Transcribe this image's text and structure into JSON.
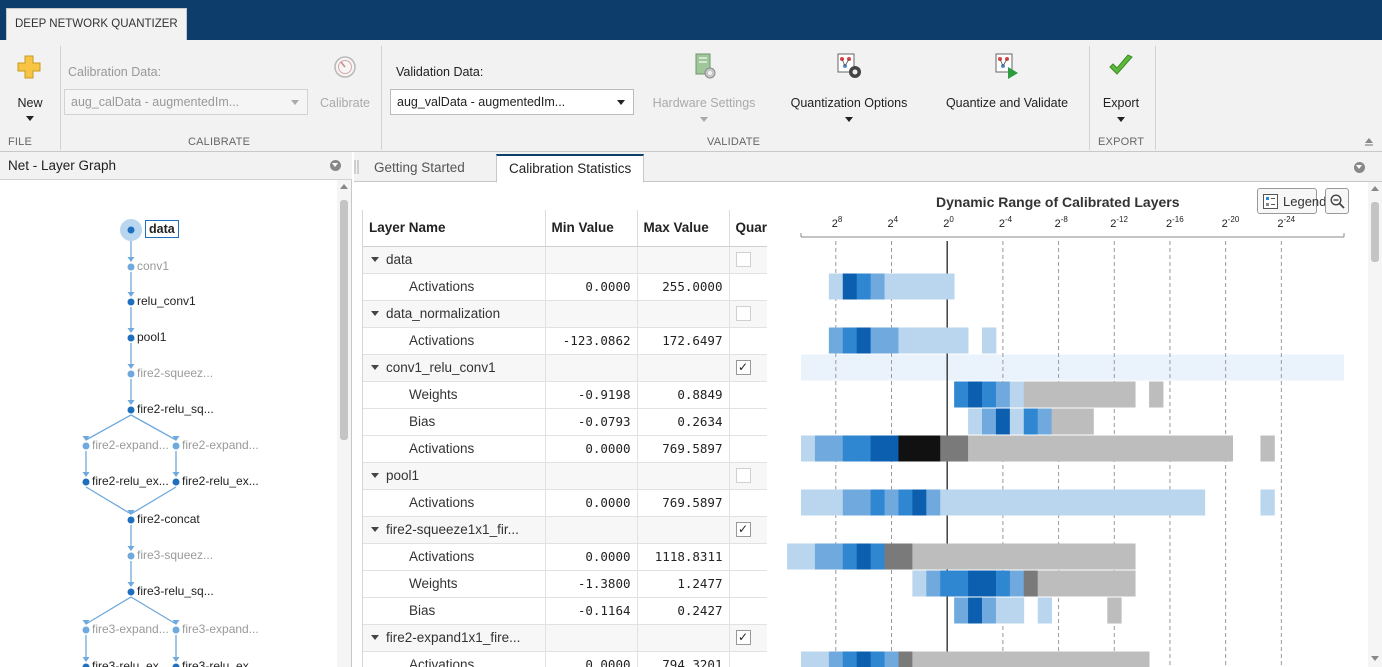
{
  "app": {
    "tab_title": "DEEP NETWORK QUANTIZER"
  },
  "toolstrip": {
    "file": {
      "section": "FILE",
      "new_label": "New"
    },
    "calibrate": {
      "section": "CALIBRATE",
      "calibration_data_label": "Calibration Data:",
      "calibration_data_value": "aug_calData - augmentedIm...",
      "calibrate_label": "Calibrate"
    },
    "validate": {
      "section": "VALIDATE",
      "validation_data_label": "Validation Data:",
      "validation_data_value": "aug_valData - augmentedIm...",
      "hardware_settings_label": "Hardware Settings",
      "quantization_options_label": "Quantization Options",
      "quantize_validate_label": "Quantize and Validate"
    },
    "export": {
      "section": "EXPORT",
      "export_label": "Export"
    }
  },
  "left_panel": {
    "title": "Net - Layer Graph",
    "nodes": [
      {
        "label": "data",
        "active": true,
        "dim": false
      },
      {
        "label": "conv1",
        "active": false,
        "dim": true
      },
      {
        "label": "relu_conv1",
        "active": false,
        "dim": false
      },
      {
        "label": "pool1",
        "active": false,
        "dim": false
      },
      {
        "label": "fire2-squeez...",
        "active": false,
        "dim": true
      },
      {
        "label": "fire2-relu_sq...",
        "active": false,
        "dim": false
      },
      {
        "label": "fire2-expand...",
        "active": false,
        "dim": true
      },
      {
        "label": "fire2-expand...",
        "active": false,
        "dim": true
      },
      {
        "label": "fire2-relu_ex...",
        "active": false,
        "dim": false
      },
      {
        "label": "fire2-relu_ex...",
        "active": false,
        "dim": false
      },
      {
        "label": "fire2-concat",
        "active": false,
        "dim": false
      },
      {
        "label": "fire3-squeez...",
        "active": false,
        "dim": true
      },
      {
        "label": "fire3-relu_sq...",
        "active": false,
        "dim": false
      },
      {
        "label": "fire3-expand...",
        "active": false,
        "dim": true
      },
      {
        "label": "fire3-expand...",
        "active": false,
        "dim": true
      },
      {
        "label": "fire3-relu_ex...",
        "active": false,
        "dim": false
      },
      {
        "label": "fire3-relu_ex...",
        "active": false,
        "dim": false
      }
    ]
  },
  "doc_tabs": [
    {
      "label": "Getting Started",
      "active": false
    },
    {
      "label": "Calibration Statistics",
      "active": true
    }
  ],
  "table": {
    "columns": [
      "Layer Name",
      "Min Value",
      "Max Value",
      "Quar"
    ],
    "rows": [
      {
        "type": "group",
        "name": "data",
        "checked": false,
        "enabled": false
      },
      {
        "type": "child",
        "name": "Activations",
        "min": "0.0000",
        "max": "255.0000"
      },
      {
        "type": "group",
        "name": "data_normalization",
        "checked": false,
        "enabled": false
      },
      {
        "type": "child",
        "name": "Activations",
        "min": "-123.0862",
        "max": "172.6497"
      },
      {
        "type": "group",
        "name": "conv1_relu_conv1",
        "checked": true,
        "enabled": true
      },
      {
        "type": "child",
        "name": "Weights",
        "min": "-0.9198",
        "max": "0.8849"
      },
      {
        "type": "child",
        "name": "Bias",
        "min": "-0.0793",
        "max": "0.2634"
      },
      {
        "type": "child",
        "name": "Activations",
        "min": "0.0000",
        "max": "769.5897"
      },
      {
        "type": "group",
        "name": "pool1",
        "checked": false,
        "enabled": false
      },
      {
        "type": "child",
        "name": "Activations",
        "min": "0.0000",
        "max": "769.5897"
      },
      {
        "type": "group",
        "name": "fire2-squeeze1x1_fir...",
        "checked": true,
        "enabled": true
      },
      {
        "type": "child",
        "name": "Activations",
        "min": "0.0000",
        "max": "1118.8311"
      },
      {
        "type": "child",
        "name": "Weights",
        "min": "-1.3800",
        "max": "1.2477"
      },
      {
        "type": "child",
        "name": "Bias",
        "min": "-0.1164",
        "max": "0.2427"
      },
      {
        "type": "group",
        "name": "fire2-expand1x1_fire...",
        "checked": true,
        "enabled": true
      },
      {
        "type": "child",
        "name": "Activations",
        "min": "0.0000",
        "max": "794.3201"
      }
    ]
  },
  "chart": {
    "title": "Dynamic Range of Calibrated Layers",
    "legend_label": "Legend",
    "colors": {
      "dark_blue": "#0b5fae",
      "blue": "#2f86d1",
      "mid_blue": "#6fa9dd",
      "light_blue": "#bad6ee",
      "gray": "#bdbdbd",
      "dark_gray": "#7a7a7a",
      "black": "#111111",
      "highlight_row": "#eaf3fb"
    }
  },
  "chart_data": {
    "type": "heatmap",
    "title": "Dynamic Range of Calibrated Layers",
    "x_tick_labels": [
      {
        "base": "2",
        "exp": "8"
      },
      {
        "base": "2",
        "exp": "4"
      },
      {
        "base": "2",
        "exp": "0"
      },
      {
        "base": "2",
        "exp": "-4"
      },
      {
        "base": "2",
        "exp": "-8"
      },
      {
        "base": "2",
        "exp": "-12"
      },
      {
        "base": "2",
        "exp": "-16"
      },
      {
        "base": "2",
        "exp": "-20"
      },
      {
        "base": "2",
        "exp": "-24"
      }
    ],
    "x_exponent_range": [
      11,
      -28
    ],
    "rows": [
      {
        "table_row": 1,
        "cells": [
          [
            8,
            "lb"
          ],
          [
            7,
            "db"
          ],
          [
            6,
            "b"
          ],
          [
            5,
            "mb"
          ],
          [
            4,
            "lb"
          ],
          [
            3,
            "lb"
          ],
          [
            2,
            "lb"
          ],
          [
            1,
            "lb"
          ],
          [
            0,
            "lb"
          ]
        ]
      },
      {
        "table_row": 3,
        "cells": [
          [
            8,
            "mb"
          ],
          [
            7,
            "b"
          ],
          [
            6,
            "db"
          ],
          [
            5,
            "mb"
          ],
          [
            4,
            "mb"
          ],
          [
            3,
            "lb"
          ],
          [
            2,
            "lb"
          ],
          [
            1,
            "lb"
          ],
          [
            0,
            "lb"
          ],
          [
            -1,
            "lb"
          ],
          [
            -3,
            "lb"
          ]
        ]
      },
      {
        "table_row": 4,
        "highlight": true,
        "cells": []
      },
      {
        "table_row": 5,
        "cells": [
          [
            -1,
            "b"
          ],
          [
            -2,
            "db"
          ],
          [
            -3,
            "b"
          ],
          [
            -4,
            "mb"
          ],
          [
            -5,
            "lb"
          ],
          [
            -6,
            "gray"
          ],
          [
            -7,
            "gray"
          ],
          [
            -8,
            "gray"
          ],
          [
            -9,
            "gray"
          ],
          [
            -10,
            "gray"
          ],
          [
            -11,
            "gray"
          ],
          [
            -12,
            "gray"
          ],
          [
            -13,
            "gray"
          ],
          [
            -15,
            "gray"
          ]
        ]
      },
      {
        "table_row": 6,
        "cells": [
          [
            -2,
            "lb"
          ],
          [
            -3,
            "mb"
          ],
          [
            -4,
            "db"
          ],
          [
            -5,
            "lb"
          ],
          [
            -6,
            "b"
          ],
          [
            -7,
            "mb"
          ],
          [
            -8,
            "gray"
          ],
          [
            -9,
            "gray"
          ],
          [
            -10,
            "gray"
          ]
        ]
      },
      {
        "table_row": 7,
        "cells": [
          [
            10,
            "lb"
          ],
          [
            9,
            "mb"
          ],
          [
            8,
            "mb"
          ],
          [
            7,
            "b"
          ],
          [
            6,
            "b"
          ],
          [
            5,
            "db"
          ],
          [
            4,
            "db"
          ],
          [
            3,
            "black"
          ],
          [
            2,
            "black"
          ],
          [
            1,
            "black"
          ],
          [
            0,
            "dgray"
          ],
          [
            -1,
            "dgray"
          ],
          [
            -2,
            "gray"
          ],
          [
            -3,
            "gray"
          ],
          [
            -4,
            "gray"
          ],
          [
            -5,
            "gray"
          ],
          [
            -6,
            "gray"
          ],
          [
            -7,
            "gray"
          ],
          [
            -8,
            "gray"
          ],
          [
            -9,
            "gray"
          ],
          [
            -10,
            "gray"
          ],
          [
            -11,
            "gray"
          ],
          [
            -12,
            "gray"
          ],
          [
            -13,
            "gray"
          ],
          [
            -14,
            "gray"
          ],
          [
            -15,
            "gray"
          ],
          [
            -16,
            "gray"
          ],
          [
            -17,
            "gray"
          ],
          [
            -18,
            "gray"
          ],
          [
            -19,
            "gray"
          ],
          [
            -20,
            "gray"
          ],
          [
            -23,
            "gray"
          ]
        ]
      },
      {
        "table_row": 9,
        "cells": [
          [
            10,
            "lb"
          ],
          [
            9,
            "lb"
          ],
          [
            8,
            "lb"
          ],
          [
            7,
            "mb"
          ],
          [
            6,
            "mb"
          ],
          [
            5,
            "b"
          ],
          [
            4,
            "mb"
          ],
          [
            3,
            "b"
          ],
          [
            2,
            "db"
          ],
          [
            1,
            "mb"
          ],
          [
            0,
            "lb"
          ],
          [
            -1,
            "lb"
          ],
          [
            -2,
            "lb"
          ],
          [
            -3,
            "lb"
          ],
          [
            -4,
            "lb"
          ],
          [
            -5,
            "lb"
          ],
          [
            -6,
            "lb"
          ],
          [
            -7,
            "lb"
          ],
          [
            -8,
            "lb"
          ],
          [
            -9,
            "lb"
          ],
          [
            -10,
            "lb"
          ],
          [
            -11,
            "lb"
          ],
          [
            -12,
            "lb"
          ],
          [
            -13,
            "lb"
          ],
          [
            -14,
            "lb"
          ],
          [
            -15,
            "lb"
          ],
          [
            -16,
            "lb"
          ],
          [
            -17,
            "lb"
          ],
          [
            -18,
            "lb"
          ],
          [
            -23,
            "lb"
          ]
        ]
      },
      {
        "table_row": 11,
        "cells": [
          [
            11,
            "lb"
          ],
          [
            10,
            "lb"
          ],
          [
            9,
            "mb"
          ],
          [
            8,
            "mb"
          ],
          [
            7,
            "b"
          ],
          [
            6,
            "db"
          ],
          [
            5,
            "b"
          ],
          [
            4,
            "dgray"
          ],
          [
            3,
            "dgray"
          ],
          [
            2,
            "gray"
          ],
          [
            1,
            "gray"
          ],
          [
            0,
            "gray"
          ],
          [
            -1,
            "gray"
          ],
          [
            -2,
            "gray"
          ],
          [
            -3,
            "gray"
          ],
          [
            -4,
            "gray"
          ],
          [
            -5,
            "gray"
          ],
          [
            -6,
            "gray"
          ],
          [
            -7,
            "gray"
          ],
          [
            -8,
            "gray"
          ],
          [
            -9,
            "gray"
          ],
          [
            -10,
            "gray"
          ],
          [
            -11,
            "gray"
          ],
          [
            -12,
            "gray"
          ],
          [
            -13,
            "gray"
          ]
        ]
      },
      {
        "table_row": 12,
        "cells": [
          [
            2,
            "lb"
          ],
          [
            1,
            "mb"
          ],
          [
            0,
            "b"
          ],
          [
            -1,
            "b"
          ],
          [
            -2,
            "db"
          ],
          [
            -3,
            "db"
          ],
          [
            -4,
            "b"
          ],
          [
            -5,
            "mb"
          ],
          [
            -6,
            "dgray"
          ],
          [
            -7,
            "gray"
          ],
          [
            -8,
            "gray"
          ],
          [
            -9,
            "gray"
          ],
          [
            -10,
            "gray"
          ],
          [
            -11,
            "gray"
          ],
          [
            -12,
            "gray"
          ],
          [
            -13,
            "gray"
          ]
        ]
      },
      {
        "table_row": 13,
        "cells": [
          [
            -1,
            "mb"
          ],
          [
            -2,
            "db"
          ],
          [
            -3,
            "mb"
          ],
          [
            -4,
            "lb"
          ],
          [
            -5,
            "lb"
          ],
          [
            -7,
            "lb"
          ],
          [
            -12,
            "gray"
          ]
        ]
      },
      {
        "table_row": 15,
        "cells": [
          [
            10,
            "lb"
          ],
          [
            9,
            "lb"
          ],
          [
            8,
            "mb"
          ],
          [
            7,
            "b"
          ],
          [
            6,
            "db"
          ],
          [
            5,
            "b"
          ],
          [
            4,
            "mb"
          ],
          [
            3,
            "dgray"
          ],
          [
            2,
            "gray"
          ],
          [
            1,
            "gray"
          ],
          [
            0,
            "gray"
          ],
          [
            -1,
            "gray"
          ],
          [
            -2,
            "gray"
          ],
          [
            -3,
            "gray"
          ],
          [
            -4,
            "gray"
          ],
          [
            -5,
            "gray"
          ],
          [
            -6,
            "gray"
          ],
          [
            -7,
            "gray"
          ],
          [
            -8,
            "gray"
          ],
          [
            -9,
            "gray"
          ],
          [
            -10,
            "gray"
          ],
          [
            -11,
            "gray"
          ],
          [
            -12,
            "gray"
          ],
          [
            -13,
            "gray"
          ],
          [
            -14,
            "gray"
          ]
        ]
      }
    ]
  }
}
